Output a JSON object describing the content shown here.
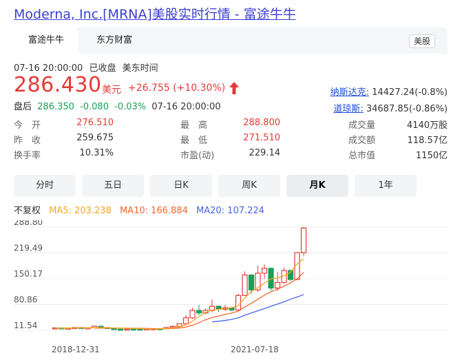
{
  "page_title": "Moderna, Inc.[MRNA]美股实时行情 - 富途牛牛",
  "source_tabs": [
    {
      "label": "富途牛牛",
      "active": true
    },
    {
      "label": "东方财富",
      "active": false
    }
  ],
  "market_badge": "美股",
  "meta": {
    "datetime": "07-16 20:00:00",
    "status": "已收盘",
    "timezone": "美东时间"
  },
  "quote": {
    "price": "286.430",
    "currency": "美元",
    "change": "+26.755",
    "change_pct": "(+10.30%)",
    "direction": "up"
  },
  "after_hours": {
    "label": "盘后",
    "price": "286.350",
    "change": "-0.080",
    "change_pct": "-0.03%",
    "time": "07-16 20:00:00"
  },
  "indices": [
    {
      "name": "纳斯达克:",
      "value": "14427.24(-0.8%)"
    },
    {
      "name": "道琼斯:",
      "value": "34687.85(-0.86%)"
    }
  ],
  "stats": [
    [
      {
        "label": "今　开",
        "value": "276.510",
        "color": "red"
      },
      {
        "label": "最　高",
        "value": "288.800",
        "color": "red"
      },
      {
        "label": "成交量",
        "value": "4140万股",
        "color": "dark"
      }
    ],
    [
      {
        "label": "昨　收",
        "value": "259.675",
        "color": "dark"
      },
      {
        "label": "最　低",
        "value": "271.510",
        "color": "red"
      },
      {
        "label": "成交额",
        "value": "118.57亿",
        "color": "dark"
      }
    ],
    [
      {
        "label": "换手率",
        "value": "10.31%",
        "color": "dark"
      },
      {
        "label": "市盈(动)",
        "value": "229.14",
        "color": "dark"
      },
      {
        "label": "总市值",
        "value": "1150亿",
        "color": "dark"
      }
    ]
  ],
  "periods": [
    {
      "label": "分时",
      "active": false
    },
    {
      "label": "五日",
      "active": false
    },
    {
      "label": "日K",
      "active": false
    },
    {
      "label": "周K",
      "active": false
    },
    {
      "label": "月K",
      "active": true
    },
    {
      "label": "1年",
      "active": false
    }
  ],
  "legend": {
    "adjust": "不复权",
    "ma5": "MA5: 203.238",
    "ma10": "MA10: 166.884",
    "ma20": "MA20: 107.224"
  },
  "colors": {
    "up": "#e53935",
    "down": "#18a058",
    "ma5": "#f5a623",
    "ma10": "#f0672a",
    "ma20": "#4a63e0",
    "accent_blue": "#3b3fd1"
  },
  "chart_data": {
    "type": "candlestick",
    "y_ticks": [
      "288.80",
      "219.49",
      "150.17",
      "80.86",
      "11.54"
    ],
    "y_range": [
      11.54,
      288.8
    ],
    "x_ticks": [
      "2018-12-31",
      "2021-07-18"
    ],
    "candles": [
      [
        17.0,
        18.5,
        15.2,
        18.0
      ],
      [
        18.0,
        19.2,
        15.8,
        16.2
      ],
      [
        16.2,
        18.0,
        15.6,
        17.3
      ],
      [
        17.3,
        19.5,
        16.8,
        19.0
      ],
      [
        19.0,
        19.8,
        16.0,
        16.8
      ],
      [
        16.8,
        18.8,
        16.4,
        18.2
      ],
      [
        18.2,
        24.0,
        17.5,
        22.5
      ],
      [
        22.5,
        23.5,
        18.0,
        19.0
      ],
      [
        19.0,
        19.5,
        15.5,
        16.2
      ],
      [
        16.2,
        17.0,
        13.8,
        14.5
      ],
      [
        14.5,
        15.5,
        13.0,
        14.0
      ],
      [
        14.0,
        15.6,
        13.5,
        15.0
      ],
      [
        15.0,
        16.0,
        14.2,
        14.8
      ],
      [
        14.8,
        15.5,
        13.7,
        14.2
      ],
      [
        14.2,
        15.8,
        13.9,
        15.4
      ],
      [
        15.4,
        16.5,
        14.5,
        16.0
      ],
      [
        16.0,
        16.8,
        14.9,
        15.8
      ],
      [
        15.8,
        19.5,
        15.2,
        19.0
      ],
      [
        19.0,
        24.0,
        18.5,
        22.0
      ],
      [
        22.0,
        30.0,
        19.5,
        29.0
      ],
      [
        29.0,
        52.0,
        28.0,
        45.0
      ],
      [
        45.0,
        72.0,
        42.0,
        65.0
      ],
      [
        65.0,
        80.0,
        52.0,
        58.0
      ],
      [
        58.0,
        70.0,
        55.0,
        65.0
      ],
      [
        65.0,
        94.0,
        60.0,
        76.0
      ],
      [
        76.0,
        78.0,
        60.0,
        68.0
      ],
      [
        68.0,
        80.0,
        63.0,
        72.0
      ],
      [
        72.0,
        74.0,
        63.0,
        66.0
      ],
      [
        66.0,
        110.0,
        64.0,
        105.0
      ],
      [
        105.0,
        170.0,
        104.0,
        160.0
      ],
      [
        160.0,
        162.0,
        110.0,
        120.0
      ],
      [
        120.0,
        185.0,
        115.0,
        165.0
      ],
      [
        165.0,
        188.0,
        150.0,
        178.0
      ],
      [
        178.0,
        180.0,
        118.0,
        125.0
      ],
      [
        125.0,
        168.0,
        117.0,
        140.0
      ],
      [
        140.0,
        180.0,
        137.0,
        172.0
      ],
      [
        172.0,
        175.0,
        143.0,
        148.0
      ],
      [
        148.0,
        222.0,
        146.0,
        220.0
      ],
      [
        220.0,
        288.8,
        210.0,
        286.4
      ]
    ],
    "ma5": [
      17.2,
      17.5,
      17.7,
      18.0,
      18.3,
      18.2,
      18.6,
      18.8,
      18.5,
      17.9,
      17.5,
      17.0,
      16.4,
      15.9,
      15.4,
      15.3,
      15.4,
      16.1,
      17.6,
      20.4,
      26.2,
      35.9,
      48.5,
      60.0,
      66.0,
      68.0,
      70.0,
      72.0,
      78.0,
      98.0,
      116.0,
      126.0,
      138.0,
      150.0,
      152.0,
      158.0,
      168.0,
      190.0,
      203.238
    ],
    "ma10": [
      null,
      null,
      null,
      null,
      null,
      null,
      17.3,
      17.5,
      17.6,
      17.5,
      17.3,
      17.1,
      17.0,
      16.7,
      16.5,
      16.2,
      16.0,
      16.0,
      16.3,
      17.4,
      20.2,
      25.1,
      32.2,
      39.8,
      45.5,
      50.0,
      54.0,
      58.0,
      63.0,
      74.0,
      84.0,
      95.0,
      106.0,
      115.0,
      122.0,
      130.0,
      139.0,
      150.0,
      166.884
    ],
    "ma20": [
      null,
      null,
      null,
      null,
      null,
      null,
      null,
      null,
      null,
      null,
      null,
      null,
      null,
      null,
      null,
      null,
      null,
      null,
      null,
      null,
      null,
      null,
      null,
      null,
      34.0,
      36.0,
      38.0,
      41.0,
      45.0,
      52.0,
      58.0,
      64.0,
      70.0,
      76.0,
      82.0,
      88.0,
      95.0,
      101.0,
      107.224
    ]
  }
}
